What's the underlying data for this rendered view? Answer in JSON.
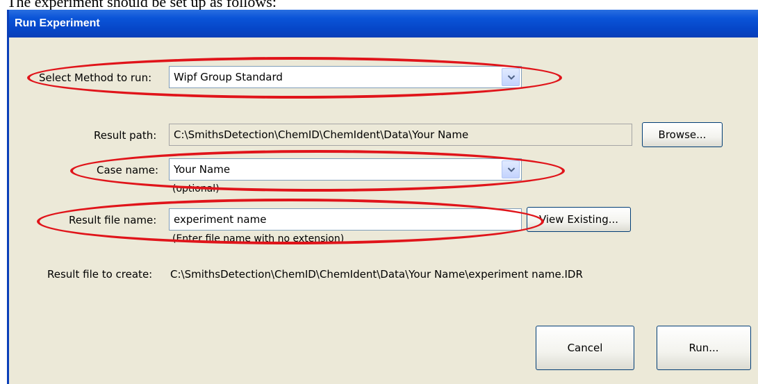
{
  "document": {
    "intro": "The experiment should be set up as follows:"
  },
  "window": {
    "title": "Run Experiment"
  },
  "method": {
    "label": "Select Method to run:",
    "value": "Wipf Group Standard"
  },
  "result_path": {
    "label": "Result path:",
    "value": "C:\\SmithsDetection\\ChemID\\ChemIdent\\Data\\Your Name",
    "browse_label": "Browse..."
  },
  "case_name": {
    "label": "Case name:",
    "value": "Your Name",
    "hint": "(optional)"
  },
  "result_file": {
    "label": "Result file name:",
    "value": "experiment name",
    "hint": "(Enter file name with no extension)",
    "view_existing_label": "View Existing..."
  },
  "result_to_create": {
    "label": "Result file to create:",
    "value": "C:\\SmithsDetection\\ChemID\\ChemIdent\\Data\\Your Name\\experiment name.IDR"
  },
  "buttons": {
    "cancel": "Cancel",
    "run": "Run..."
  },
  "colors": {
    "highlight_ellipse": "#e0141a",
    "title_bar": "#0a54d8",
    "dialog_bg": "#ece9d8"
  },
  "icons": {
    "dropdown": "chevron-down-icon"
  }
}
